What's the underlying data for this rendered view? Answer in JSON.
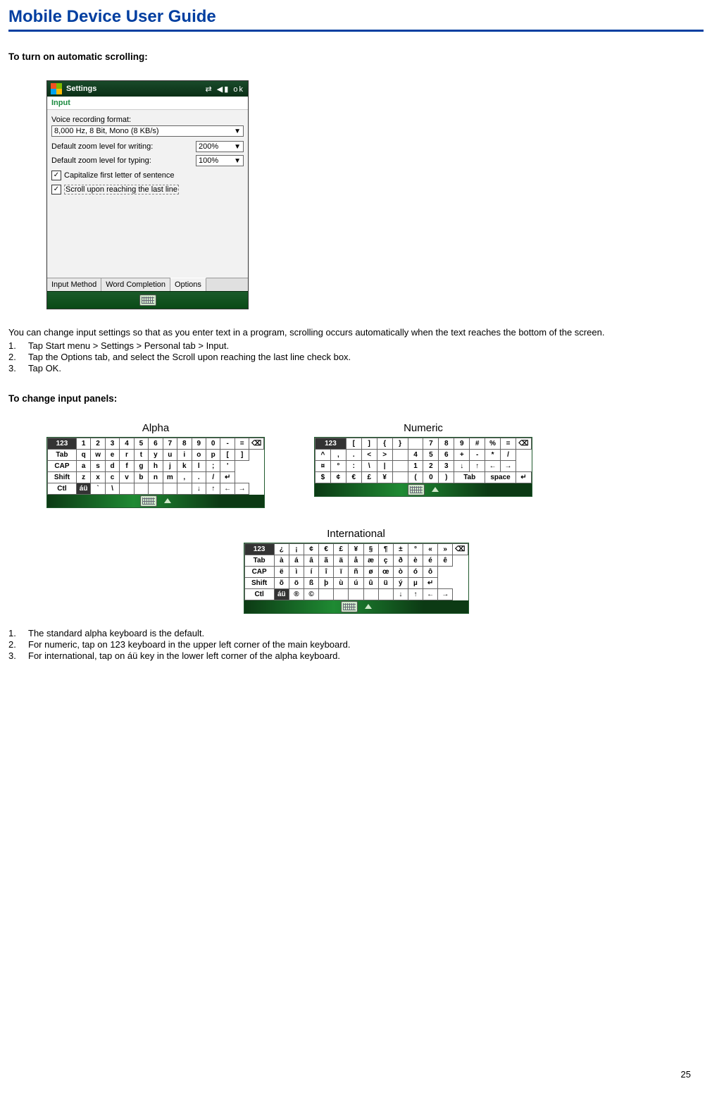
{
  "title": "Mobile Device User Guide",
  "section1_heading": "To turn on automatic scrolling:",
  "settings_shot": {
    "titlebar": {
      "title": "Settings",
      "right_icons": "⇄  ◀▮  ok"
    },
    "subtitle": "Input",
    "recformat_label": "Voice recording format:",
    "recformat_value": "8,000 Hz, 8 Bit, Mono (8 KB/s)",
    "writezoom_label": "Default zoom level for writing:",
    "writezoom_value": "200%",
    "typezoom_label": "Default zoom level for typing:",
    "typezoom_value": "100%",
    "cap_label": "Capitalize first letter of sentence",
    "scroll_label": "Scroll upon reaching the last line",
    "tabs": {
      "t1": "Input Method",
      "t2": "Word Completion",
      "t3": "Options"
    }
  },
  "para1": "You can change input settings so that as you enter text in a program, scrolling occurs automatically when the text reaches the bottom of the screen.",
  "steps1": {
    "s1": "Tap Start menu > Settings > Personal tab > Input.",
    "s2": "Tap the Options tab, and select the Scroll upon reaching the last line check box.",
    "s3": "Tap OK."
  },
  "section2_heading": "To change input panels:",
  "panel_titles": {
    "alpha": "Alpha",
    "numeric": "Numeric",
    "intl": "International"
  },
  "kbd_alpha": {
    "r1": [
      "123",
      "1",
      "2",
      "3",
      "4",
      "5",
      "6",
      "7",
      "8",
      "9",
      "0",
      "-",
      "=",
      "⌫"
    ],
    "r2": [
      "Tab",
      "q",
      "w",
      "e",
      "r",
      "t",
      "y",
      "u",
      "i",
      "o",
      "p",
      "[",
      "]"
    ],
    "r3": [
      "CAP",
      "a",
      "s",
      "d",
      "f",
      "g",
      "h",
      "j",
      "k",
      "l",
      ";",
      "'"
    ],
    "r4": [
      "Shift",
      "z",
      "x",
      "c",
      "v",
      "b",
      "n",
      "m",
      ",",
      ".",
      "/",
      "↵"
    ],
    "r5": [
      "Ctl",
      "áü",
      "`",
      "\\",
      "",
      "",
      "",
      "",
      "",
      "↓",
      "↑",
      "←",
      "→"
    ]
  },
  "kbd_numeric": {
    "r1": [
      "123",
      "[",
      "]",
      "{",
      "}",
      "",
      "7",
      "8",
      "9",
      "#",
      "%",
      "=",
      "⌫"
    ],
    "r2": [
      "^",
      ",",
      ".",
      "<",
      ">",
      "",
      "4",
      "5",
      "6",
      "+",
      "-",
      "*",
      "/"
    ],
    "r3": [
      "¤",
      "°",
      ":",
      "\\",
      "|",
      "",
      "1",
      "2",
      "3",
      "↓",
      "↑",
      "←",
      "→"
    ],
    "r4": [
      "$",
      "¢",
      "€",
      "£",
      "¥",
      "",
      "(",
      "0",
      ")",
      "Tab",
      "space",
      "↵"
    ]
  },
  "kbd_intl": {
    "r1": [
      "123",
      "¿",
      "¡",
      "¢",
      "€",
      "£",
      "¥",
      "§",
      "¶",
      "±",
      "°",
      "«",
      "»",
      "⌫"
    ],
    "r2": [
      "Tab",
      "à",
      "á",
      "â",
      "ã",
      "ä",
      "å",
      "æ",
      "ç",
      "ð",
      "è",
      "é",
      "ê"
    ],
    "r3": [
      "CAP",
      "ë",
      "ì",
      "í",
      "î",
      "ï",
      "ñ",
      "ø",
      "œ",
      "ò",
      "ó",
      "ô"
    ],
    "r4": [
      "Shift",
      "õ",
      "ö",
      "ß",
      "þ",
      "ù",
      "ú",
      "û",
      "ü",
      "ý",
      "µ",
      "↵"
    ],
    "r5": [
      "Ctl",
      "áü",
      "®",
      "©",
      "",
      "",
      "",
      "",
      "",
      "↓",
      "↑",
      "←",
      "→"
    ]
  },
  "steps2": {
    "s1": "The standard alpha keyboard is the default.",
    "s2": "For numeric, tap on 123 keyboard in the upper left corner of the main keyboard.",
    "s3": "For international, tap on áü key in the lower left corner of the alpha keyboard."
  },
  "page_number": "25",
  "chart_data": {
    "type": "table",
    "title": "On-screen keyboard layouts (Alpha / Numeric / International)",
    "series": [
      {
        "name": "Alpha",
        "values": [
          [
            "123",
            "1",
            "2",
            "3",
            "4",
            "5",
            "6",
            "7",
            "8",
            "9",
            "0",
            "-",
            "=",
            "⌫"
          ],
          [
            "Tab",
            "q",
            "w",
            "e",
            "r",
            "t",
            "y",
            "u",
            "i",
            "o",
            "p",
            "[",
            "]"
          ],
          [
            "CAP",
            "a",
            "s",
            "d",
            "f",
            "g",
            "h",
            "j",
            "k",
            "l",
            ";",
            "'"
          ],
          [
            "Shift",
            "z",
            "x",
            "c",
            "v",
            "b",
            "n",
            "m",
            ",",
            ".",
            "/",
            "↵"
          ],
          [
            "Ctl",
            "áü",
            "`",
            "\\",
            "",
            "",
            "",
            "",
            "",
            "↓",
            "↑",
            "←",
            "→"
          ]
        ]
      },
      {
        "name": "Numeric",
        "values": [
          [
            "123",
            "[",
            "]",
            "{",
            "}",
            "",
            "7",
            "8",
            "9",
            "#",
            "%",
            "=",
            "⌫"
          ],
          [
            "^",
            ",",
            ".",
            "<",
            ">",
            "",
            "4",
            "5",
            "6",
            "+",
            "-",
            "*",
            "/"
          ],
          [
            "¤",
            "°",
            ":",
            "\\",
            "|",
            "",
            "1",
            "2",
            "3",
            "↓",
            "↑",
            "←",
            "→"
          ],
          [
            "$",
            "¢",
            "€",
            "£",
            "¥",
            "",
            "(",
            "0",
            ")",
            "Tab",
            "space",
            "↵"
          ]
        ]
      },
      {
        "name": "International",
        "values": [
          [
            "123",
            "¿",
            "¡",
            "¢",
            "€",
            "£",
            "¥",
            "§",
            "¶",
            "±",
            "°",
            "«",
            "»",
            "⌫"
          ],
          [
            "Tab",
            "à",
            "á",
            "â",
            "ã",
            "ä",
            "å",
            "æ",
            "ç",
            "ð",
            "è",
            "é",
            "ê"
          ],
          [
            "CAP",
            "ë",
            "ì",
            "í",
            "î",
            "ï",
            "ñ",
            "ø",
            "œ",
            "ò",
            "ó",
            "ô"
          ],
          [
            "Shift",
            "õ",
            "ö",
            "ß",
            "þ",
            "ù",
            "ú",
            "û",
            "ü",
            "ý",
            "µ",
            "↵"
          ],
          [
            "Ctl",
            "áü",
            "®",
            "©",
            "",
            "",
            "",
            "",
            "",
            "↓",
            "↑",
            "←",
            "→"
          ]
        ]
      }
    ]
  }
}
